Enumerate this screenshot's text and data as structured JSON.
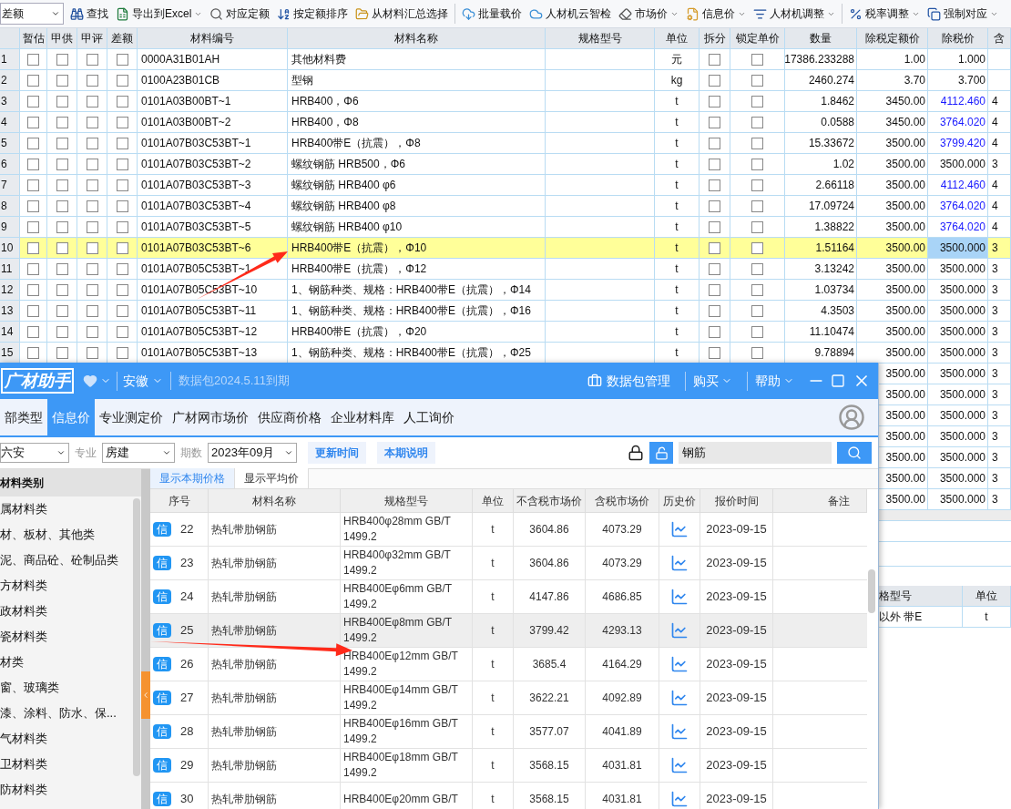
{
  "toolbar": {
    "select": {
      "value": "差额"
    },
    "groups": [
      [
        {
          "label": "查找",
          "dropdown": false
        },
        {
          "label": "导出到Excel",
          "dropdown": true
        },
        {
          "label": "对应定额",
          "dropdown": false
        },
        {
          "label": "按定额排序",
          "dropdown": false
        },
        {
          "label": "从材料汇总选择",
          "dropdown": false
        }
      ],
      [
        {
          "label": "批量载价",
          "dropdown": false
        },
        {
          "label": "人材机云智检",
          "dropdown": false
        },
        {
          "label": "市场价",
          "dropdown": true
        },
        {
          "label": "信息价",
          "dropdown": true
        },
        {
          "label": "人材机调整",
          "dropdown": true
        }
      ],
      [
        {
          "label": "税率调整",
          "dropdown": true
        },
        {
          "label": "强制对应",
          "dropdown": true
        }
      ]
    ]
  },
  "table": {
    "columns": [
      "暂估",
      "甲供",
      "甲评",
      "差额",
      "材料编号",
      "材料名称",
      "规格型号",
      "单位",
      "拆分",
      "锁定单价",
      "数量",
      "除税定额价",
      "除税价",
      "含"
    ],
    "rows": [
      {
        "no": "1",
        "flags": [
          false,
          false,
          false,
          false
        ],
        "code": "0000A31B01AH",
        "name": "其他材料费",
        "unit": "元",
        "split": false,
        "locked": false,
        "qty": "17386.233288",
        "quota_price": "1.00",
        "price": "1.000",
        "adjusted": false,
        "column_15": "",
        "selected": false
      },
      {
        "no": "2",
        "flags": [
          false,
          false,
          false,
          false
        ],
        "code": "0100A23B01CB",
        "name": "型钢",
        "unit": "kg",
        "split": false,
        "locked": false,
        "qty": "2460.274",
        "quota_price": "3.70",
        "price": "3.700",
        "adjusted": false,
        "column_15": "",
        "selected": false
      },
      {
        "no": "3",
        "flags": [
          false,
          false,
          false,
          false
        ],
        "code": "0101A03B00BT~1",
        "name": "HRB400，Φ6",
        "unit": "t",
        "split": false,
        "locked": false,
        "qty": "1.8462",
        "quota_price": "3450.00",
        "price": "4112.460",
        "adjusted": true,
        "column_15": "4",
        "selected": false
      },
      {
        "no": "4",
        "flags": [
          false,
          false,
          false,
          false
        ],
        "code": "0101A03B00BT~2",
        "name": "HRB400，Φ8",
        "unit": "t",
        "split": false,
        "locked": false,
        "qty": "0.0588",
        "quota_price": "3450.00",
        "price": "3764.020",
        "adjusted": true,
        "column_15": "4",
        "selected": false
      },
      {
        "no": "5",
        "flags": [
          false,
          false,
          false,
          false
        ],
        "code": "0101A07B03C53BT~1",
        "name": "HRB400带E（抗震），Φ8",
        "unit": "t",
        "split": false,
        "locked": false,
        "qty": "15.33672",
        "quota_price": "3500.00",
        "price": "3799.420",
        "adjusted": true,
        "column_15": "4",
        "selected": false
      },
      {
        "no": "6",
        "flags": [
          false,
          false,
          false,
          false
        ],
        "code": "0101A07B03C53BT~2",
        "name": "螺纹钢筋 HRB500，Φ6",
        "unit": "t",
        "split": false,
        "locked": false,
        "qty": "1.02",
        "quota_price": "3500.00",
        "price": "3500.000",
        "adjusted": false,
        "column_15": "3",
        "selected": false
      },
      {
        "no": "7",
        "flags": [
          false,
          false,
          false,
          false
        ],
        "code": "0101A07B03C53BT~3",
        "name": "螺纹钢筋 HRB400 φ6",
        "unit": "t",
        "split": false,
        "locked": false,
        "qty": "2.66118",
        "quota_price": "3500.00",
        "price": "4112.460",
        "adjusted": true,
        "column_15": "4",
        "selected": false
      },
      {
        "no": "8",
        "flags": [
          false,
          false,
          false,
          false
        ],
        "code": "0101A07B03C53BT~4",
        "name": "螺纹钢筋 HRB400 φ8",
        "unit": "t",
        "split": false,
        "locked": false,
        "qty": "17.09724",
        "quota_price": "3500.00",
        "price": "3764.020",
        "adjusted": true,
        "column_15": "4",
        "selected": false
      },
      {
        "no": "9",
        "flags": [
          false,
          false,
          false,
          false
        ],
        "code": "0101A07B03C53BT~5",
        "name": "螺纹钢筋 HRB400 φ10",
        "unit": "t",
        "split": false,
        "locked": false,
        "qty": "1.38822",
        "quota_price": "3500.00",
        "price": "3764.020",
        "adjusted": true,
        "column_15": "4",
        "selected": false
      },
      {
        "no": "10",
        "flags": [
          false,
          false,
          false,
          false
        ],
        "code": "0101A07B03C53BT~6",
        "name": "HRB400带E（抗震），Φ10",
        "unit": "t",
        "split": false,
        "locked": false,
        "qty": "1.51164",
        "quota_price": "3500.00",
        "price": "3500.000",
        "adjusted": false,
        "column_15": "3",
        "selected": true
      },
      {
        "no": "11",
        "flags": [
          false,
          false,
          false,
          false
        ],
        "code": "0101A07B05C53BT~1",
        "name": "HRB400带E（抗震），Φ12",
        "unit": "t",
        "split": false,
        "locked": false,
        "qty": "3.13242",
        "quota_price": "3500.00",
        "price": "3500.000",
        "adjusted": false,
        "column_15": "3",
        "selected": false
      },
      {
        "no": "12",
        "flags": [
          false,
          false,
          false,
          false
        ],
        "code": "0101A07B05C53BT~10",
        "name": "1、钢筋种类、规格：HRB400带E（抗震），Φ14",
        "unit": "t",
        "split": false,
        "locked": false,
        "qty": "1.03734",
        "quota_price": "3500.00",
        "price": "3500.000",
        "adjusted": false,
        "column_15": "3",
        "selected": false
      },
      {
        "no": "13",
        "flags": [
          false,
          false,
          false,
          false
        ],
        "code": "0101A07B05C53BT~11",
        "name": "1、钢筋种类、规格：HRB400带E（抗震），Φ16",
        "unit": "t",
        "split": false,
        "locked": false,
        "qty": "4.3503",
        "quota_price": "3500.00",
        "price": "3500.000",
        "adjusted": false,
        "column_15": "3",
        "selected": false
      },
      {
        "no": "14",
        "flags": [
          false,
          false,
          false,
          false
        ],
        "code": "0101A07B05C53BT~12",
        "name": "HRB400带E（抗震），Φ20",
        "unit": "t",
        "split": false,
        "locked": false,
        "qty": "11.10474",
        "quota_price": "3500.00",
        "price": "3500.000",
        "adjusted": false,
        "column_15": "3",
        "selected": false
      },
      {
        "no": "15",
        "flags": [
          false,
          false,
          false,
          false
        ],
        "code": "0101A07B05C53BT~13",
        "name": "1、钢筋种类、规格：HRB400带E（抗震），Φ25",
        "unit": "t",
        "split": false,
        "locked": false,
        "qty": "9.78894",
        "quota_price": "3500.00",
        "price": "3500.000",
        "adjusted": false,
        "column_15": "3",
        "selected": false
      }
    ],
    "rows_partly_hidden": [
      {
        "quota_price": "3500.00",
        "price": "3500.000",
        "column_15": "3"
      },
      {
        "quota_price": "3500.00",
        "price": "3500.000",
        "column_15": "3"
      },
      {
        "quota_price": "3500.00",
        "price": "3500.000",
        "column_15": "3"
      },
      {
        "quota_price": "3500.00",
        "price": "3500.000",
        "column_15": "3"
      },
      {
        "quota_price": "3500.00",
        "price": "3500.000",
        "column_15": "3"
      },
      {
        "quota_price": "3500.00",
        "price": "3500.000",
        "column_15": "3"
      },
      {
        "quota_price": "3500.00",
        "price": "3500.000",
        "column_15": "3"
      }
    ]
  },
  "lower_table": {
    "columns": [
      "格型号",
      "单位"
    ],
    "rows": [
      [
        "以外 带E",
        "t"
      ]
    ]
  },
  "popup": {
    "logo": "广材助手",
    "region": "安徽",
    "package_note": "数据包2024.5.11到期",
    "package_button": "数据包管理",
    "menus": [
      "购买",
      "帮助"
    ],
    "tabs": [
      {
        "label": "部类型",
        "selected": false
      },
      {
        "label": "信息价",
        "selected": true
      },
      {
        "label": "专业测定价",
        "selected": false
      },
      {
        "label": "广材网市场价",
        "selected": false
      },
      {
        "label": "供应商价格",
        "selected": false
      },
      {
        "label": "企业材料库",
        "selected": false
      },
      {
        "label": "人工询价",
        "selected": false
      }
    ],
    "filters": {
      "city": "六安",
      "specialty_label": "专业",
      "specialty": "房建",
      "period_label": "期数",
      "period": "2023年09月",
      "buttons": [
        "更新时间",
        "本期说明"
      ],
      "search": "钢筋"
    },
    "sidebar": {
      "title": "材料类别",
      "items": [
        "属材料类",
        "材、板材、其他类",
        "泥、商品砼、砼制品类",
        "方材料类",
        "政材料类",
        "瓷材料类",
        "材类",
        "窗、玻璃类",
        "漆、涂料、防水、保...",
        "气材料类",
        "卫材料类",
        "防材料类"
      ]
    },
    "subtabs": [
      {
        "label": "显示本期价格",
        "selected": true
      },
      {
        "label": "显示平均价",
        "selected": false
      }
    ],
    "columns": [
      "序号",
      "材料名称",
      "规格型号",
      "单位",
      "不含税市场价",
      "含税市场价",
      "历史价",
      "报价时间",
      "备注"
    ],
    "rows": [
      {
        "badge": "信",
        "no": "22",
        "name": "热轧带肋钢筋",
        "spec": "HRB400φ28mm GB/T 1499.2",
        "unit": "t",
        "price_ex": "3604.86",
        "price_in": "4073.29",
        "date": "2023-09-15",
        "selected": false
      },
      {
        "badge": "信",
        "no": "23",
        "name": "热轧带肋钢筋",
        "spec": "HRB400φ32mm GB/T 1499.2",
        "unit": "t",
        "price_ex": "3604.86",
        "price_in": "4073.29",
        "date": "2023-09-15",
        "selected": false
      },
      {
        "badge": "信",
        "no": "24",
        "name": "热轧带肋钢筋",
        "spec": "HRB400Eφ6mm GB/T 1499.2",
        "unit": "t",
        "price_ex": "4147.86",
        "price_in": "4686.85",
        "date": "2023-09-15",
        "selected": false
      },
      {
        "badge": "信",
        "no": "25",
        "name": "热轧带肋钢筋",
        "spec": "HRB400Eφ8mm GB/T 1499.2",
        "unit": "t",
        "price_ex": "3799.42",
        "price_in": "4293.13",
        "date": "2023-09-15",
        "selected": true
      },
      {
        "badge": "信",
        "no": "26",
        "name": "热轧带肋钢筋",
        "spec": "HRB400Eφ12mm GB/T 1499.2",
        "unit": "t",
        "price_ex": "3685.4",
        "price_in": "4164.29",
        "date": "2023-09-15",
        "selected": false
      },
      {
        "badge": "信",
        "no": "27",
        "name": "热轧带肋钢筋",
        "spec": "HRB400Eφ14mm GB/T 1499.2",
        "unit": "t",
        "price_ex": "3622.21",
        "price_in": "4092.89",
        "date": "2023-09-15",
        "selected": false
      },
      {
        "badge": "信",
        "no": "28",
        "name": "热轧带肋钢筋",
        "spec": "HRB400Eφ16mm GB/T 1499.2",
        "unit": "t",
        "price_ex": "3577.07",
        "price_in": "4041.89",
        "date": "2023-09-15",
        "selected": false
      },
      {
        "badge": "信",
        "no": "29",
        "name": "热轧带肋钢筋",
        "spec": "HRB400Eφ18mm GB/T 1499.2",
        "unit": "t",
        "price_ex": "3568.15",
        "price_in": "4031.81",
        "date": "2023-09-15",
        "selected": false
      },
      {
        "badge": "信",
        "no": "30",
        "name": "热轧带肋钢筋",
        "spec": "HRB400Eφ20mm GB/T",
        "unit": "t",
        "price_ex": "3568.15",
        "price_in": "4031.81",
        "date": "2023-09-15",
        "selected": false
      }
    ]
  }
}
